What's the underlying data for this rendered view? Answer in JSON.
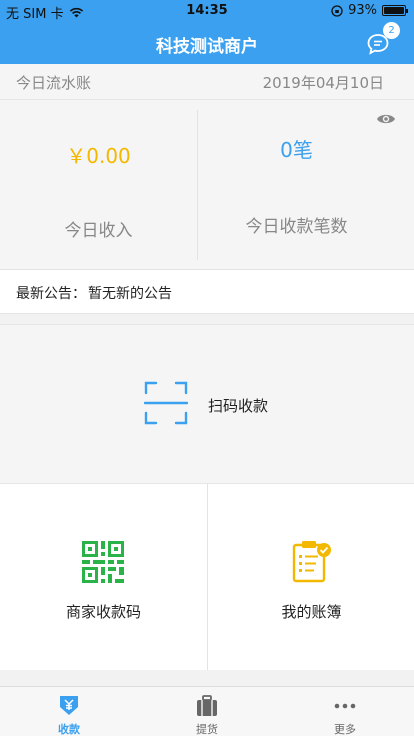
{
  "status_bar": {
    "carrier": "无 SIM 卡",
    "time": "14:35",
    "battery": "93%",
    "battery_level": 0.93
  },
  "nav": {
    "title": "科技测试商户",
    "message_badge": "2"
  },
  "date_row": {
    "label": "今日流水账",
    "date": "2019年04月10日"
  },
  "stats": {
    "income": {
      "value": "￥0.00",
      "label": "今日收入",
      "color": "#f3b800"
    },
    "count": {
      "value": "0笔",
      "label": "今日收款笔数",
      "color": "#3aa0ef"
    }
  },
  "notice": {
    "label": "最新公告：",
    "text": "暂无新的公告"
  },
  "scan": {
    "label": "扫码收款"
  },
  "tiles": [
    {
      "label": "商家收款码",
      "icon": "qr-code-icon",
      "color": "#2bb34a"
    },
    {
      "label": "我的账簿",
      "icon": "ledger-icon",
      "color": "#f3b800"
    }
  ],
  "tabbar": [
    {
      "label": "收款",
      "icon": "collect-icon",
      "active": true
    },
    {
      "label": "提货",
      "icon": "suitcase-icon",
      "active": false
    },
    {
      "label": "更多",
      "icon": "more-icon",
      "active": false
    }
  ],
  "colors": {
    "accent": "#3aa0ef",
    "income": "#f3b800",
    "qr": "#2bb34a"
  }
}
